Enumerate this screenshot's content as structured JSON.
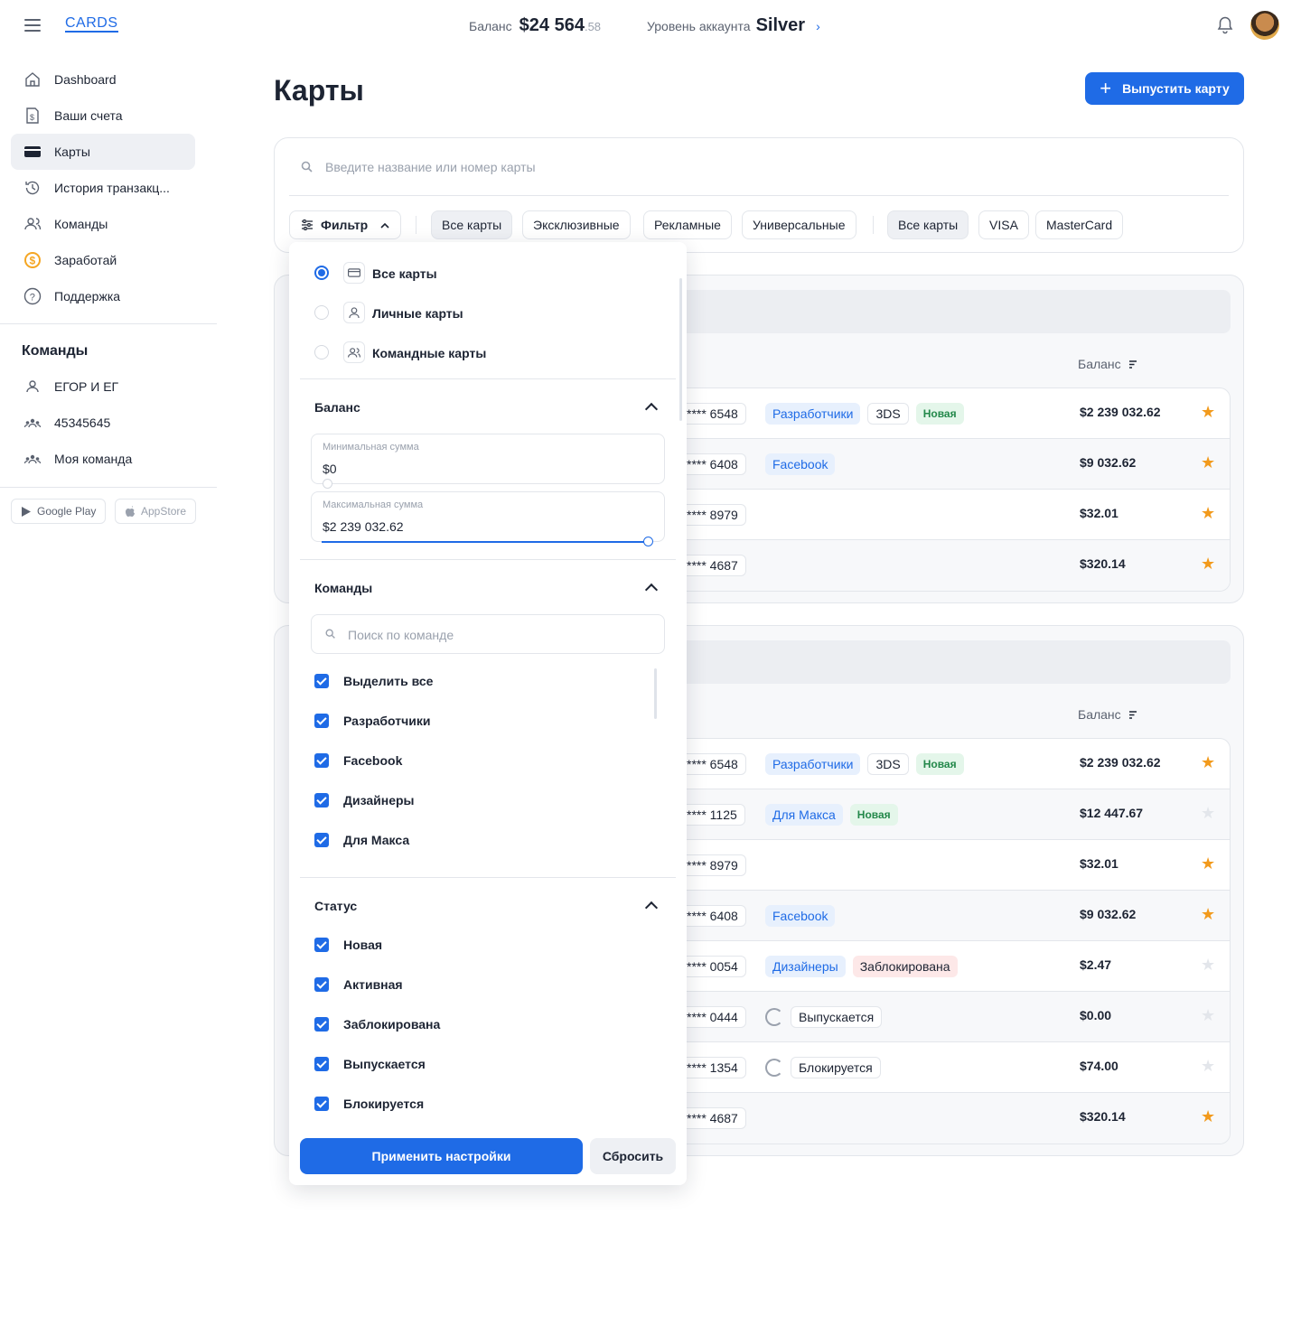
{
  "app": {
    "logo": "CARDS"
  },
  "header": {
    "balance_label": "Баланс",
    "balance_amount": "$24 564",
    "balance_cents": ".58",
    "level_label": "Уровень аккаунта",
    "level_value": "Silver",
    "level_chevron": "›"
  },
  "sidebar": {
    "items": [
      {
        "label": "Dashboard",
        "icon": "home-icon"
      },
      {
        "label": "Ваши счета",
        "icon": "document-dollar-icon"
      },
      {
        "label": "Карты",
        "icon": "card-icon",
        "active": true
      },
      {
        "label": "История транзакц...",
        "icon": "history-icon"
      },
      {
        "label": "Команды",
        "icon": "team-icon"
      },
      {
        "label": "Заработай",
        "icon": "coin-icon"
      },
      {
        "label": "Поддержка",
        "icon": "help-icon"
      }
    ],
    "teams_title": "Команды",
    "teams": [
      {
        "label": "ЕГОР И ЕГ",
        "icon": "user-icon"
      },
      {
        "label": "45345645",
        "icon": "group-icon"
      },
      {
        "label": "Моя команда",
        "icon": "group-icon"
      }
    ],
    "stores": [
      "Google Play",
      "AppStore"
    ]
  },
  "page": {
    "title": "Карты",
    "issue_button": "Выпустить карту",
    "search_placeholder": "Введите название или номер карты",
    "filter_button": "Фильтр",
    "type_chips": [
      "Все карты",
      "Эксклюзивные",
      "Рекламные",
      "Универсальные"
    ],
    "brand_chips": [
      "Все карты",
      "VISA",
      "MasterCard"
    ],
    "balance_header": "Баланс"
  },
  "groups": [
    {
      "rows": [
        {
          "number": "**** 6548",
          "tags": [
            {
              "type": "team",
              "text": "Разработчики"
            },
            {
              "type": "plain",
              "text": "3DS"
            },
            {
              "type": "new",
              "text": "Новая"
            }
          ],
          "amount": "$2 239 032.62",
          "fav": true
        },
        {
          "number": "**** 6408",
          "tags": [
            {
              "type": "team",
              "text": "Facebook"
            }
          ],
          "amount": "$9 032.62",
          "fav": true
        },
        {
          "number": "**** 8979",
          "tags": [],
          "amount": "$32.01",
          "fav": true
        },
        {
          "number": "**** 4687",
          "tags": [],
          "amount": "$320.14",
          "fav": true
        }
      ]
    },
    {
      "rows": [
        {
          "number": "**** 6548",
          "tags": [
            {
              "type": "team",
              "text": "Разработчики"
            },
            {
              "type": "plain",
              "text": "3DS"
            },
            {
              "type": "new",
              "text": "Новая"
            }
          ],
          "amount": "$2 239 032.62",
          "fav": true
        },
        {
          "number": "**** 1125",
          "tags": [
            {
              "type": "team",
              "text": "Для Макса"
            },
            {
              "type": "new",
              "text": "Новая"
            }
          ],
          "amount": "$12 447.67",
          "fav": false
        },
        {
          "number": "**** 8979",
          "tags": [],
          "amount": "$32.01",
          "fav": true
        },
        {
          "number": "**** 6408",
          "tags": [
            {
              "type": "team",
              "text": "Facebook"
            }
          ],
          "amount": "$9 032.62",
          "fav": true
        },
        {
          "number": "**** 0054",
          "tags": [
            {
              "type": "team",
              "text": "Дизайнеры"
            },
            {
              "type": "blocked",
              "text": "Заблокирована"
            }
          ],
          "amount": "$2.47",
          "fav": false
        },
        {
          "number": "**** 0444",
          "tags": [
            {
              "type": "spinner",
              "text": ""
            },
            {
              "type": "plain",
              "text": "Выпускается"
            }
          ],
          "amount": "$0.00",
          "fav": false
        },
        {
          "number": "**** 1354",
          "tags": [
            {
              "type": "spinner",
              "text": ""
            },
            {
              "type": "plain",
              "text": "Блокируется"
            }
          ],
          "amount": "$74.00",
          "fav": false
        },
        {
          "number": "**** 4687",
          "tags": [],
          "amount": "$320.14",
          "fav": true
        }
      ]
    }
  ],
  "filter_panel": {
    "ownership": [
      {
        "label": "Все карты",
        "checked": true
      },
      {
        "label": "Личные карты",
        "checked": false
      },
      {
        "label": "Командные карты",
        "checked": false
      }
    ],
    "balance_title": "Баланс",
    "min_label": "Минимальная сумма",
    "min_value": "$0",
    "max_label": "Максимальная сумма",
    "max_value": "$2 239 032.62",
    "teams_title": "Команды",
    "team_search_placeholder": "Поиск по команде",
    "teams": [
      "Выделить все",
      "Разработчики",
      "Facebook",
      "Дизайнеры",
      "Для Макса"
    ],
    "status_title": "Статус",
    "statuses": [
      "Новая",
      "Активная",
      "Заблокирована",
      "Выпускается",
      "Блокируется"
    ],
    "apply": "Применить настройки",
    "reset": "Сбросить"
  },
  "colors": {
    "accent": "#1f6be6",
    "star": "#f29a1c",
    "new_badge": "#23884a",
    "blocked_badge": "#fde8e8"
  }
}
